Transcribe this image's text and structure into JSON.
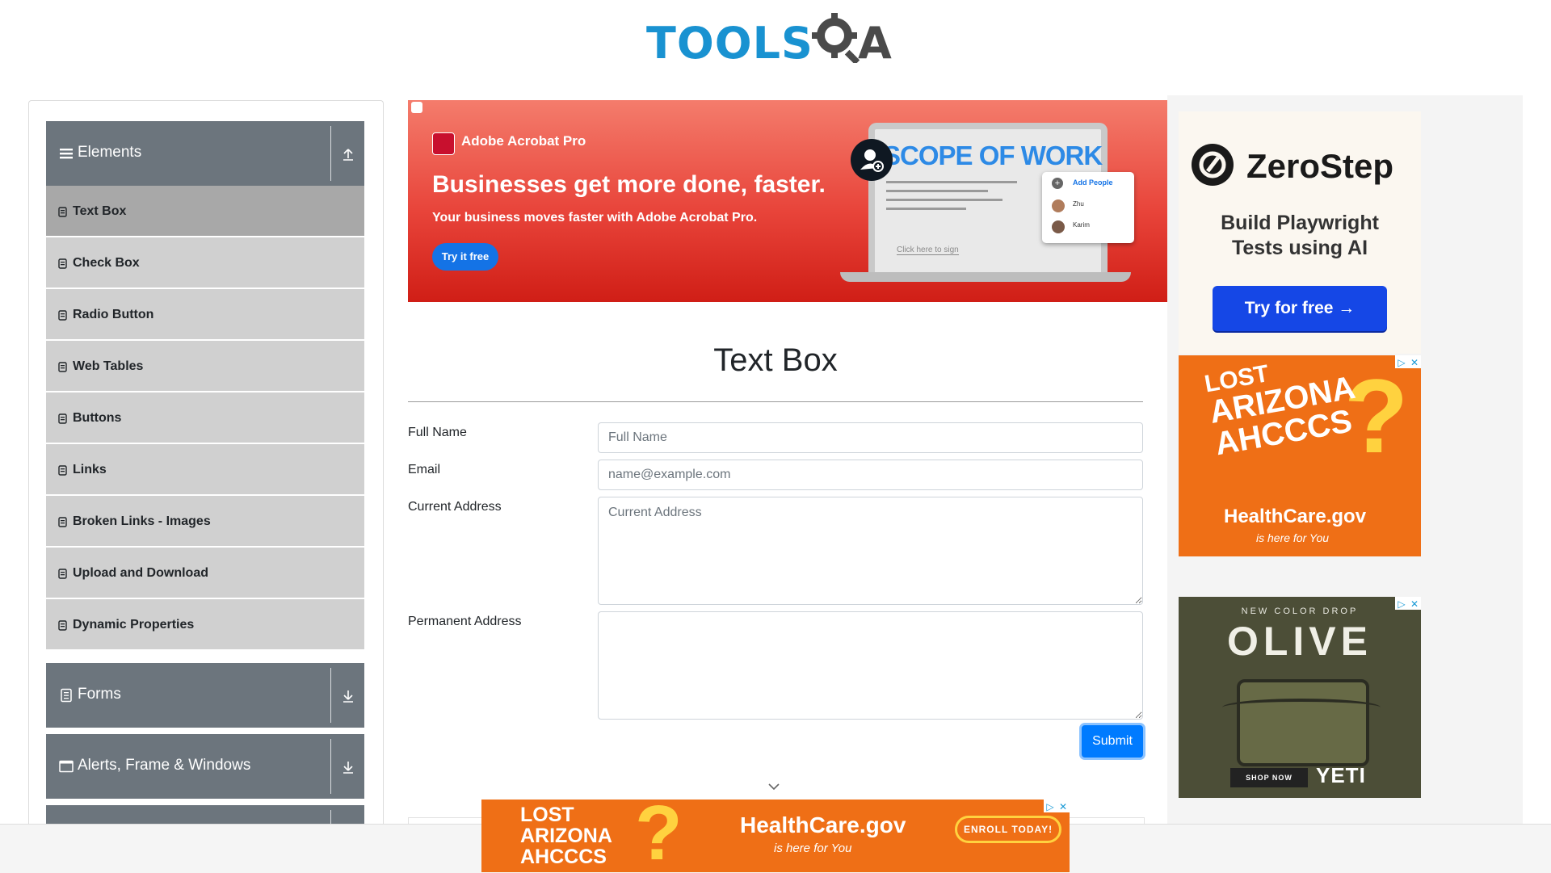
{
  "logo": {
    "part1": "TOOLS",
    "part2": "A"
  },
  "sidebar": {
    "groups": {
      "elements": "Elements",
      "forms": "Forms",
      "alerts": "Alerts, Frame & Windows"
    },
    "items": [
      {
        "label": "Text Box",
        "active": true
      },
      {
        "label": "Check Box"
      },
      {
        "label": "Radio Button"
      },
      {
        "label": "Web Tables"
      },
      {
        "label": "Buttons"
      },
      {
        "label": "Links"
      },
      {
        "label": "Broken Links - Images"
      },
      {
        "label": "Upload and Download"
      },
      {
        "label": "Dynamic Properties"
      }
    ]
  },
  "banner_ad": {
    "brand": "Adobe Acrobat Pro",
    "headline": "Businesses get more done, faster.",
    "subline": "Your business moves faster with Adobe Acrobat Pro.",
    "cta": "Try it free",
    "doc_title": "SCOPE OF WORK",
    "panel_add": "Add People",
    "panel_person1": "Zhu",
    "panel_person2": "Karim",
    "sign_hint": "Click here to sign"
  },
  "main": {
    "title": "Text Box",
    "fields": {
      "full_name_label": "Full Name",
      "full_name_placeholder": "Full Name",
      "email_label": "Email",
      "email_placeholder": "name@example.com",
      "current_address_label": "Current Address",
      "current_address_placeholder": "Current Address",
      "permanent_address_label": "Permanent Address"
    },
    "submit": "Submit"
  },
  "ads": {
    "zerostep": {
      "name": "ZeroStep",
      "line1": "Build Playwright",
      "line2": "Tests using AI",
      "cta": "Try for free →"
    },
    "healthcare": {
      "lost": "LOST",
      "arizona": "ARIZONA",
      "ahcccs": "AHCCCS",
      "site": "HealthCare.gov",
      "tagline": "is here for You"
    },
    "yeti": {
      "kicker": "NEW COLOR DROP",
      "headline": "OLIVE",
      "shop": "SHOP NOW",
      "brand": "YETI"
    },
    "bottom": {
      "lost": "LOST",
      "arizona": "ARIZONA",
      "ahcccs": "AHCCCS",
      "site": "HealthCare.gov",
      "tagline": "is here for You",
      "cta": "ENROLL TODAY!"
    }
  },
  "colors": {
    "sidebar_header": "#6c757d",
    "menu_item": "#d0d0d0",
    "menu_active": "#a8a8a8",
    "primary": "#007bff",
    "logo_blue": "#1992d1"
  }
}
